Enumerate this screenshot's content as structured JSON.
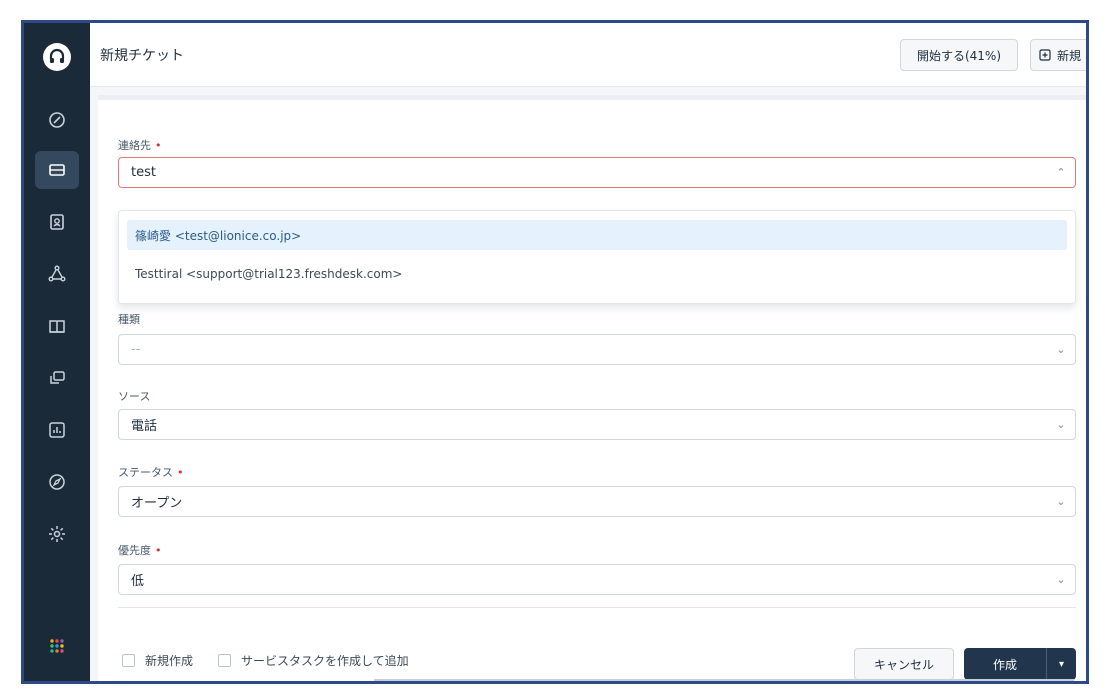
{
  "header": {
    "title": "新規チケット",
    "trial_button": "開始する(41%)",
    "new_button": "新規"
  },
  "form": {
    "contact": {
      "label": "連絡先",
      "required_mark": "•",
      "value": "test",
      "suggestions": [
        "篠崎愛 <test@lionice.co.jp>",
        "Testtiral <support@trial123.freshdesk.com>"
      ]
    },
    "type": {
      "label": "種類",
      "placeholder": "--"
    },
    "source": {
      "label": "ソース",
      "value": "電話"
    },
    "status": {
      "label": "ステータス",
      "required_mark": "•",
      "value": "オープン"
    },
    "priority": {
      "label": "優先度",
      "required_mark": "•",
      "value": "低"
    }
  },
  "footer": {
    "checkbox_create_another": "新規作成",
    "checkbox_service_task": "サービスタスクを作成して追加",
    "cancel_label": "キャンセル",
    "create_label": "作成"
  },
  "icons": {
    "chevron_up": "⌃",
    "chevron_down": "⌄",
    "split_caret": "▾"
  },
  "colors": {
    "sidebar": "#1b2a38",
    "accent_dark": "#21364c",
    "error_border": "#e07a7a",
    "highlight": "#e5f2fd",
    "frame_border": "#2d4a86"
  }
}
